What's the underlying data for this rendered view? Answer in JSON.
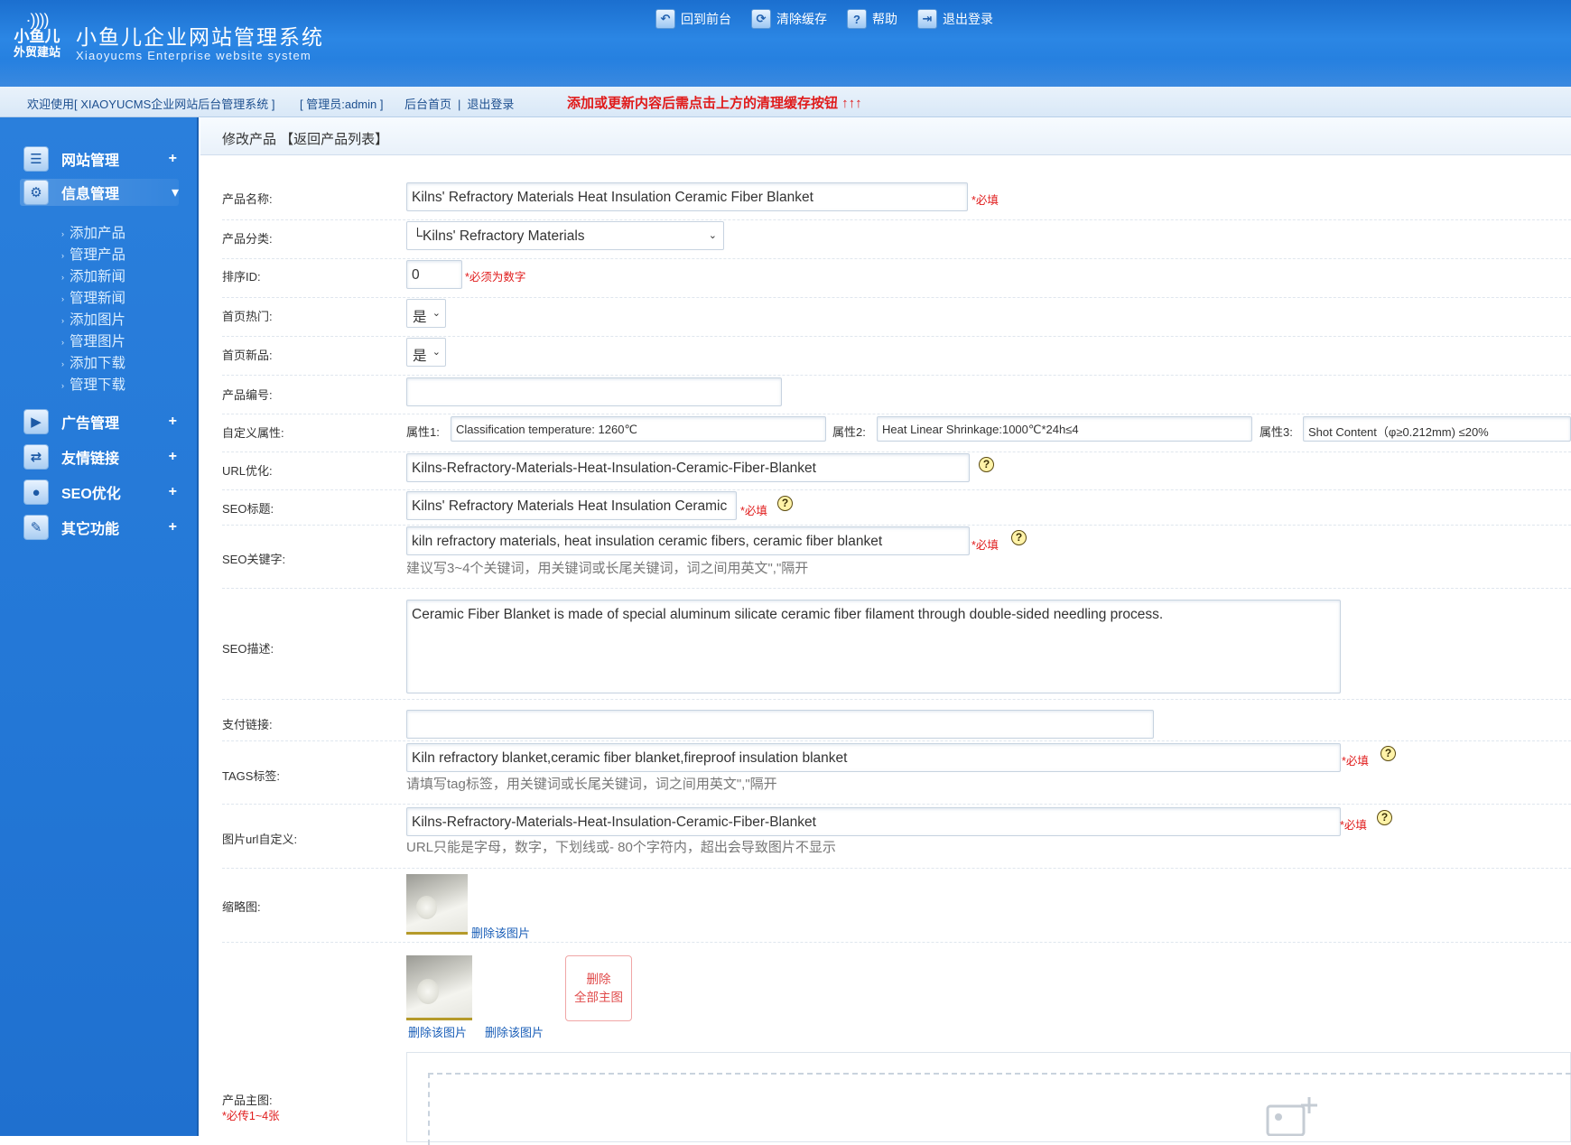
{
  "header": {
    "logo_line1": "小鱼儿",
    "logo_line2": "外贸建站",
    "title": "小鱼儿企业网站管理系统",
    "subtitle": "Xiaoyucms Enterprise website system",
    "actions": [
      {
        "label": "回到前台",
        "icon": "return-icon"
      },
      {
        "label": "清除缓存",
        "icon": "clear-cache-icon"
      },
      {
        "label": "帮助",
        "icon": "help-icon"
      },
      {
        "label": "退出登录",
        "icon": "logout-icon"
      }
    ]
  },
  "infobar": {
    "welcome": "欢迎使用[ XIAOYUCMS企业网站后台管理系统 ]",
    "admin": "[ 管理员:admin ]",
    "home_link": "后台首页",
    "separator": "|",
    "logout_link": "退出登录",
    "notice": "添加或更新内容后需点击上方的清理缓存按钮 ↑↑↑"
  },
  "sidebar": {
    "menus": [
      {
        "label": "网站管理",
        "toggle": "+",
        "icon": "site-icon"
      },
      {
        "label": "信息管理",
        "toggle": "▾",
        "icon": "gear-icon"
      },
      {
        "label": "广告管理",
        "toggle": "+",
        "icon": "ad-icon"
      },
      {
        "label": "友情链接",
        "toggle": "+",
        "icon": "link-icon"
      },
      {
        "label": "SEO优化",
        "toggle": "+",
        "icon": "seo-icon"
      },
      {
        "label": "其它功能",
        "toggle": "+",
        "icon": "tools-icon"
      }
    ],
    "submenu": [
      "添加产品",
      "管理产品",
      "添加新闻",
      "管理新闻",
      "添加图片",
      "管理图片",
      "添加下载",
      "管理下载"
    ]
  },
  "crumb": "修改产品 【返回产品列表】",
  "form": {
    "name_label": "产品名称:",
    "name_value": "Kilns' Refractory Materials Heat Insulation Ceramic Fiber Blanket",
    "required": "*必填",
    "category_label": "产品分类:",
    "category_value": "└Kilns' Refractory Materials",
    "sort_label": "排序ID:",
    "sort_value": "0",
    "sort_note": "*必须为数字",
    "hot_label": "首页热门:",
    "hot_value": "是",
    "new_label": "首页新品:",
    "new_value": "是",
    "code_label": "产品编号:",
    "code_value": "",
    "attr_label": "自定义属性:",
    "attr1_label": "属性1:",
    "attr1_value": "Classification temperature: 1260℃",
    "attr2_label": "属性2:",
    "attr2_value": "Heat Linear Shrinkage:1000℃*24h≤4",
    "attr3_label": "属性3:",
    "attr3_value": "Shot Content（φ≥0.212mm) ≤20%",
    "url_label": "URL优化:",
    "url_value": "Kilns-Refractory-Materials-Heat-Insulation-Ceramic-Fiber-Blanket",
    "seo_title_label": "SEO标题:",
    "seo_title_value": "Kilns' Refractory Materials Heat Insulation Ceramic",
    "seo_kw_label": "SEO关键字:",
    "seo_kw_value": "kiln refractory materials, heat insulation ceramic fibers, ceramic fiber blanket",
    "seo_kw_hint": "建议写3~4个关键词，用关键词或长尾关键词，词之间用英文\",\"隔开",
    "seo_desc_label": "SEO描述:",
    "seo_desc_value": "Ceramic Fiber Blanket is made of special aluminum silicate ceramic fiber filament through double-sided needling process.",
    "pay_label": "支付链接:",
    "pay_value": "",
    "tags_label": "TAGS标签:",
    "tags_value": "Kiln refractory blanket,ceramic fiber blanket,fireproof insulation blanket",
    "tags_hint": "请填写tag标签，用关键词或长尾关键词，词之间用英文\",\"隔开",
    "img_url_label": "图片url自定义:",
    "img_url_value": "Kilns-Refractory-Materials-Heat-Insulation-Ceramic-Fiber-Blanket",
    "img_url_hint": "URL只能是字母，数字，下划线或- 80个字符内，超出会导致图片不显示",
    "thumb_label": "缩略图:",
    "delete_image": "删除该图片",
    "delete_all_line1": "删除",
    "delete_all_line2": "全部主图",
    "main_img_label": "产品主图:",
    "main_img_note": "*必传1~4张",
    "help_glyph": "?",
    "select_glyph": "⌄"
  }
}
